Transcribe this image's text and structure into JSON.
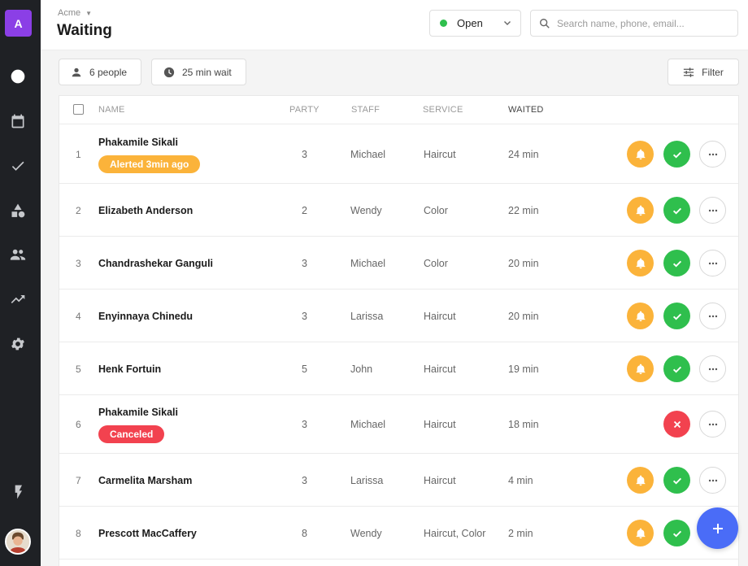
{
  "colors": {
    "sidebar": "#1f2125",
    "brand": "#8b3fe6",
    "alert": "#fbb33a",
    "success": "#2fbf4d",
    "danger": "#f2424f",
    "primary": "#4a6cf7"
  },
  "sidebar": {
    "logo_letter": "A",
    "items": [
      {
        "icon": "clock-icon",
        "active": true
      },
      {
        "icon": "calendar-icon",
        "active": false
      },
      {
        "icon": "check-icon",
        "active": false
      },
      {
        "icon": "shapes-icon",
        "active": false
      },
      {
        "icon": "people-icon",
        "active": false
      },
      {
        "icon": "trending-icon",
        "active": false
      },
      {
        "icon": "gear-icon",
        "active": false
      }
    ],
    "bottom_icon": "lightning-icon",
    "avatar": "user-avatar"
  },
  "header": {
    "org": "Acme",
    "title": "Waiting",
    "status": "Open",
    "search_placeholder": "Search name, phone, email..."
  },
  "toolbar": {
    "people_label": "6 people",
    "wait_label": "25 min wait",
    "filter_label": "Filter"
  },
  "table": {
    "columns": {
      "name": "NAME",
      "party": "PARTY",
      "staff": "STAFF",
      "service": "SERVICE",
      "waited": "WAITED"
    },
    "rows": [
      {
        "index": "1",
        "name": "Phakamile Sikali",
        "badge": "Alerted 3min ago",
        "badge_type": "alerted",
        "party": "3",
        "staff": "Michael",
        "service": "Haircut",
        "waited": "24 min",
        "actions": [
          "bell",
          "check",
          "more"
        ]
      },
      {
        "index": "2",
        "name": "Elizabeth Anderson",
        "badge": "",
        "badge_type": "",
        "party": "2",
        "staff": "Wendy",
        "service": "Color",
        "waited": "22 min",
        "actions": [
          "bell",
          "check",
          "more"
        ]
      },
      {
        "index": "3",
        "name": "Chandrashekar Ganguli",
        "badge": "",
        "badge_type": "",
        "party": "3",
        "staff": "Michael",
        "service": "Color",
        "waited": "20 min",
        "actions": [
          "bell",
          "check",
          "more"
        ]
      },
      {
        "index": "4",
        "name": "Enyinnaya Chinedu",
        "badge": "",
        "badge_type": "",
        "party": "3",
        "staff": "Larissa",
        "service": "Haircut",
        "waited": "20 min",
        "actions": [
          "bell",
          "check",
          "more"
        ]
      },
      {
        "index": "5",
        "name": "Henk Fortuin",
        "badge": "",
        "badge_type": "",
        "party": "5",
        "staff": "John",
        "service": "Haircut",
        "waited": "19 min",
        "actions": [
          "bell",
          "check",
          "more"
        ]
      },
      {
        "index": "6",
        "name": "Phakamile Sikali",
        "badge": "Canceled",
        "badge_type": "canceled",
        "party": "3",
        "staff": "Michael",
        "service": "Haircut",
        "waited": "18 min",
        "actions": [
          "cancel",
          "more"
        ]
      },
      {
        "index": "7",
        "name": "Carmelita Marsham",
        "badge": "",
        "badge_type": "",
        "party": "3",
        "staff": "Larissa",
        "service": "Haircut",
        "waited": "4 min",
        "actions": [
          "bell",
          "check",
          "more"
        ]
      },
      {
        "index": "8",
        "name": "Prescott MacCaffery",
        "badge": "",
        "badge_type": "",
        "party": "8",
        "staff": "Wendy",
        "service": "Haircut, Color",
        "waited": "2 min",
        "actions": [
          "bell",
          "check"
        ]
      }
    ]
  }
}
